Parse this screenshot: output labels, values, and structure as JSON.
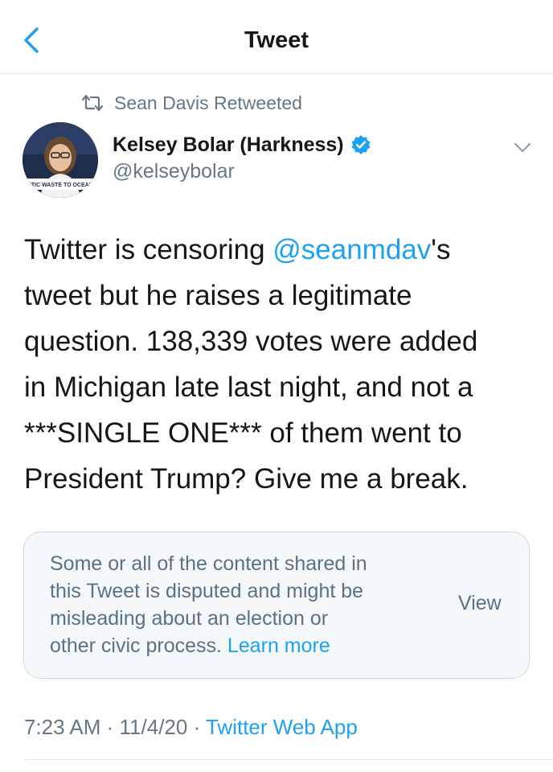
{
  "header": {
    "title": "Tweet"
  },
  "retweet": {
    "label": "Sean Davis Retweeted"
  },
  "author": {
    "name": "Kelsey Bolar (Harkness)",
    "handle": "@kelseybolar",
    "avatar_caption": "\"STIC WASTE TO OCEAN\""
  },
  "tweet": {
    "lines": [
      {
        "before": "Twitter is censoring ",
        "mention": "@seanmdav",
        "after": "'s"
      },
      {
        "text": "tweet but he raises a legitimate"
      },
      {
        "text": "question. 138,339 votes were added"
      },
      {
        "text": "in Michigan late last night, and not a"
      },
      {
        "text": "***SINGLE ONE*** of them went to"
      },
      {
        "text": "President Trump? Give me a break."
      }
    ]
  },
  "notice": {
    "lines": [
      "Some or all of the content shared in",
      "this Tweet is disputed and might be",
      "misleading about an election or"
    ],
    "last_line_before": "other civic process. ",
    "learn_more": "Learn more",
    "view_label": "View"
  },
  "meta": {
    "time": "7:23 AM",
    "separator": " · ",
    "date": "11/4/20",
    "app": "Twitter Web App"
  },
  "colors": {
    "accent": "#1da1f2",
    "secondary_text": "#657786",
    "notice_bg": "#f5f8fa"
  },
  "icons": [
    "back-chevron-icon",
    "retweet-icon",
    "verified-badge-icon",
    "caret-down-icon"
  ]
}
